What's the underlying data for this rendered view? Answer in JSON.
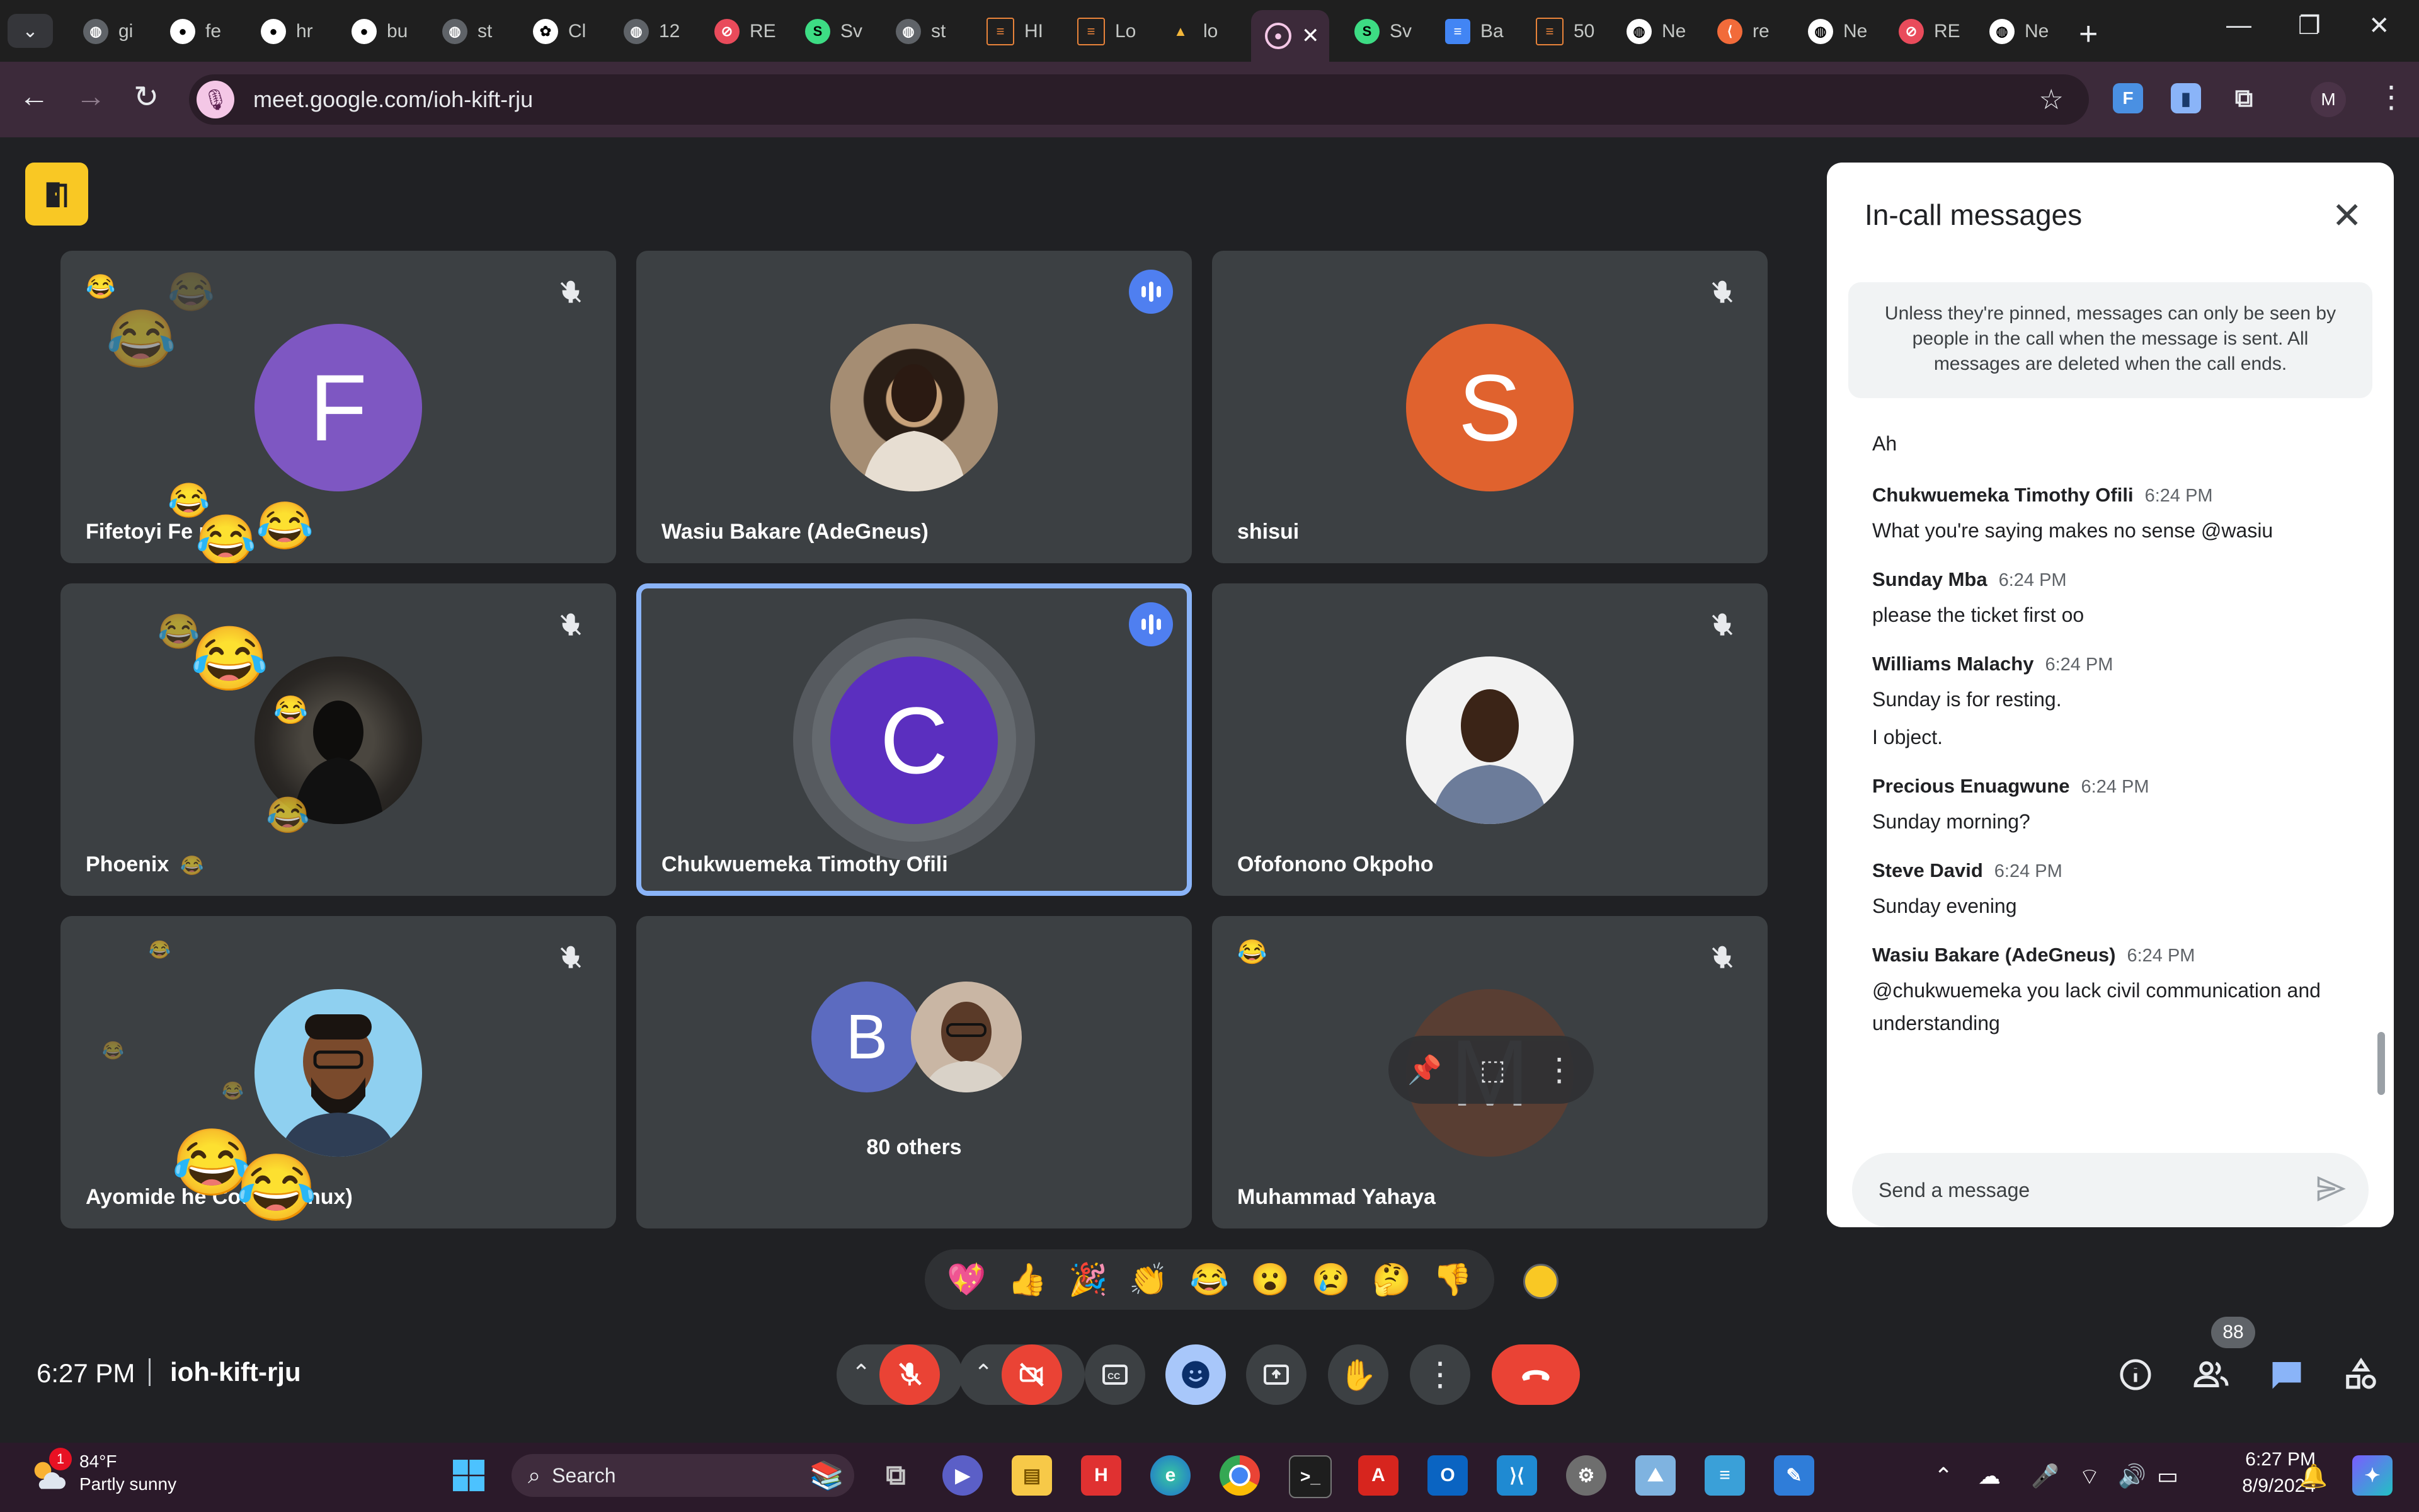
{
  "browser": {
    "tabs": [
      {
        "label": "gi",
        "icon": "globe-icon"
      },
      {
        "label": "fe",
        "icon": "github-icon"
      },
      {
        "label": "hr",
        "icon": "github-icon"
      },
      {
        "label": "bu",
        "icon": "github-icon"
      },
      {
        "label": "st",
        "icon": "globe-icon"
      },
      {
        "label": "Cl",
        "icon": "chatgpt-icon"
      },
      {
        "label": "12",
        "icon": "globe-icon"
      },
      {
        "label": "RE",
        "icon": "app-icon"
      },
      {
        "label": "Sv",
        "icon": "svelte-icon"
      },
      {
        "label": "st",
        "icon": "globe-icon"
      },
      {
        "label": "HI",
        "icon": "doc-icon"
      },
      {
        "label": "Lo",
        "icon": "doc-icon"
      },
      {
        "label": "lo",
        "icon": "mountain-icon"
      },
      {
        "label": "",
        "icon": "meet-record-icon"
      },
      {
        "label": "Sv",
        "icon": "svelte-icon"
      },
      {
        "label": "Ba",
        "icon": "docs-icon"
      },
      {
        "label": "50",
        "icon": "doc-icon"
      },
      {
        "label": "Ne",
        "icon": "globe-icon"
      },
      {
        "label": "re",
        "icon": "app-icon"
      },
      {
        "label": "Ne",
        "icon": "globe-icon"
      },
      {
        "label": "RE",
        "icon": "app-icon"
      },
      {
        "label": "Ne",
        "icon": "globe-icon"
      }
    ],
    "url": "meet.google.com/ioh-kift-rju",
    "profile_initial": "M"
  },
  "tiles": [
    {
      "name": "Fifetoyi Fe",
      "name_tail": "n",
      "initial": "F",
      "color": "#7e57c2"
    },
    {
      "name": "Wasiu Bakare (AdeGneus)"
    },
    {
      "name": "shisui",
      "initial": "S",
      "color": "#e0622e"
    },
    {
      "name": "Phoenix"
    },
    {
      "name": "Chukwuemeka Timothy Ofili",
      "initial": "C",
      "color": "#5b2fbf"
    },
    {
      "name": "Ofofonono Okpoho"
    },
    {
      "name": "Ayomide ",
      "name_tail": "he Code Ghinux)"
    },
    {
      "others_label": "80 others",
      "initial": "B",
      "color": "#5c6bc0"
    },
    {
      "name": "Muhammad Yahaya",
      "initial": "M"
    }
  ],
  "chat": {
    "title": "In-call messages",
    "notice": "Unless they're pinned, messages can only be seen by people in the call when the message is sent. All messages are deleted when the call ends.",
    "first_line": "Ah",
    "messages": [
      {
        "sender": "Chukwuemeka Timothy Ofili",
        "time": "6:24 PM",
        "lines": [
          "What you're saying makes no sense @wasiu"
        ]
      },
      {
        "sender": "Sunday Mba",
        "time": "6:24 PM",
        "lines": [
          "please the ticket first oo"
        ]
      },
      {
        "sender": "Williams Malachy",
        "time": "6:24 PM",
        "lines": [
          "Sunday is for resting.",
          "I object."
        ]
      },
      {
        "sender": "Precious Enuagwune",
        "time": "6:24 PM",
        "lines": [
          "Sunday morning?"
        ]
      },
      {
        "sender": "Steve David",
        "time": "6:24 PM",
        "lines": [
          "Sunday evening"
        ]
      },
      {
        "sender": "Wasiu Bakare (AdeGneus)",
        "time": "6:24 PM",
        "lines": [
          "@chukwuemeka you lack civil communication and",
          "understanding"
        ]
      }
    ],
    "input_placeholder": "Send a message"
  },
  "reactions": [
    "💖",
    "👍",
    "🎉",
    "👏",
    "😂",
    "😮",
    "😢",
    "🤔",
    "👎"
  ],
  "meeting": {
    "time": "6:27 PM",
    "code": "ioh-kift-rju",
    "participants_count": "88"
  },
  "taskbar": {
    "weather_temp": "84°F",
    "weather_desc": "Partly sunny",
    "weather_badge": "1",
    "search_label": "Search",
    "clock_time": "6:27 PM",
    "clock_date": "8/9/2024"
  },
  "colors": {
    "accent": "#8ab4f8",
    "end_call": "#ea4335",
    "chrome_active": "#3c2a3a",
    "tile": "#3c4043"
  }
}
